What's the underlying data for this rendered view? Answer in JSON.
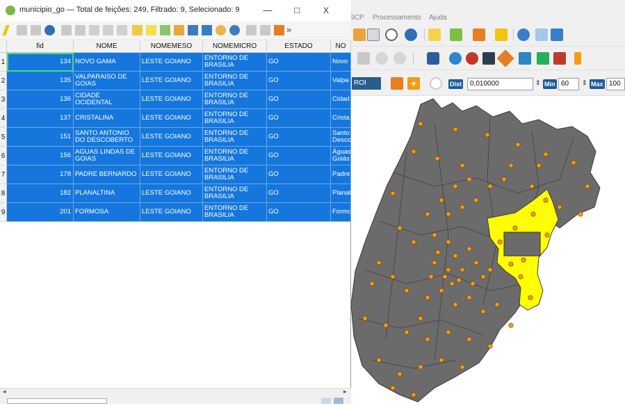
{
  "window": {
    "title": "municipio_go — Total de feições: 249, Filtrado: 9, Selecionado: 9",
    "minimize": "—",
    "maximize": "□",
    "close": "X",
    "overflow": "»"
  },
  "qgis_menu": {
    "partial": "SCP",
    "process": "Processamento",
    "help": "Ajuda"
  },
  "roi_toolbar": {
    "roi_label": "ROI",
    "dist_label": "Dist",
    "dist_value": "0,010000",
    "min_label": "Min",
    "min_value": "60",
    "max_label": "Max",
    "max_value": "100"
  },
  "table": {
    "columns": [
      "fid",
      "NOME",
      "NOMEMESO",
      "NOMEMICRO",
      "ESTADO",
      "NO"
    ],
    "rows": [
      {
        "n": "1",
        "fid": "134",
        "nome": "NOVO GAMA",
        "meso": "LESTE GOIANO",
        "micro": "ENTORNO DE BRASILIA",
        "estado": "GO",
        "extra": "Novo"
      },
      {
        "n": "2",
        "fid": "135",
        "nome": "VALPARAISO DE GOIAS",
        "meso": "LESTE GOIANO",
        "micro": "ENTORNO DE BRASILIA",
        "estado": "GO",
        "extra": "Valpa"
      },
      {
        "n": "3",
        "fid": "136",
        "nome": "CIDADE OCIDENTAL",
        "meso": "LESTE GOIANO",
        "micro": "ENTORNO DE BRASILIA",
        "estado": "GO",
        "extra": "Cidad"
      },
      {
        "n": "4",
        "fid": "137",
        "nome": "CRISTALINA",
        "meso": "LESTE GOIANO",
        "micro": "ENTORNO DE BRASILIA",
        "estado": "GO",
        "extra": "Crista"
      },
      {
        "n": "5",
        "fid": "151",
        "nome": "SANTO ANTONIO DO DESCOBERTO",
        "meso": "LESTE GOIANO",
        "micro": "ENTORNO DE BRASILIA",
        "estado": "GO",
        "extra": "Santo Desco"
      },
      {
        "n": "6",
        "fid": "156",
        "nome": "AGUAS LINDAS DE GOIAS",
        "meso": "LESTE GOIANO",
        "micro": "ENTORNO DE BRASILIA",
        "estado": "GO",
        "extra": "Águas Goiás"
      },
      {
        "n": "7",
        "fid": "178",
        "nome": "PADRE BERNARDO",
        "meso": "LESTE GOIANO",
        "micro": "ENTORNO DE BRASILIA",
        "estado": "GO",
        "extra": "Padre"
      },
      {
        "n": "8",
        "fid": "182",
        "nome": "PLANALTINA",
        "meso": "LESTE GOIANO",
        "micro": "ENTORNO DE BRASILIA",
        "estado": "GO",
        "extra": "Planal"
      },
      {
        "n": "9",
        "fid": "201",
        "nome": "FORMOSA",
        "meso": "LESTE GOIANO",
        "micro": "ENTORNO DE BRASILIA",
        "estado": "GO",
        "extra": "Formo"
      }
    ]
  },
  "colors": {
    "selection": "#1577dd",
    "map_fill": "#6b6b6b",
    "highlight": "#ffff00",
    "point": "#f39c12"
  }
}
